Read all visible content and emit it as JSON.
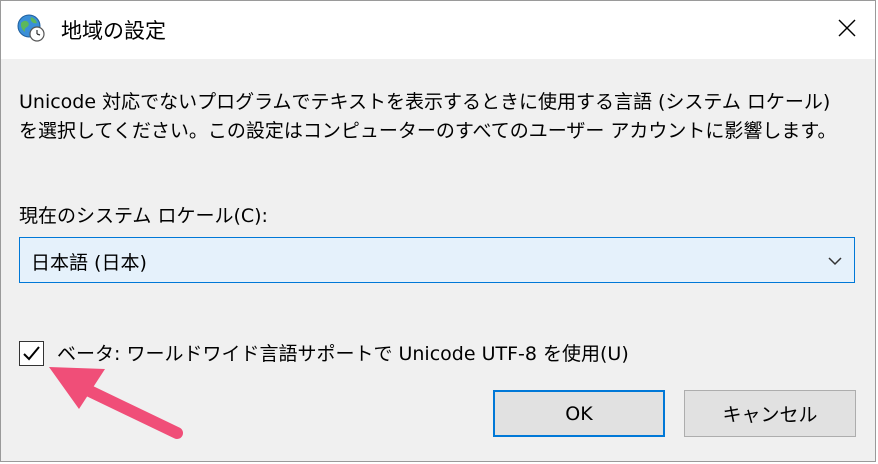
{
  "window": {
    "title": "地域の設定",
    "title_icon": "globe-clock-icon",
    "close_icon": "close-icon"
  },
  "content": {
    "description": "Unicode 対応でないプログラムでテキストを表示するときに使用する言語 (システム ロケール) を選択してください。この設定はコンピューターのすべてのユーザー アカウントに影響します。",
    "locale_label": "現在のシステム ロケール(C):",
    "locale_value": "日本語 (日本)",
    "utf8_checkbox": {
      "label": "ベータ: ワールドワイド言語サポートで Unicode UTF-8 を使用(U)",
      "checked": true
    }
  },
  "buttons": {
    "ok_label": "OK",
    "cancel_label": "キャンセル"
  },
  "colors": {
    "accent": "#0078d7",
    "annotation_arrow": "#f04e78",
    "dialog_background": "#f0f0f0"
  }
}
